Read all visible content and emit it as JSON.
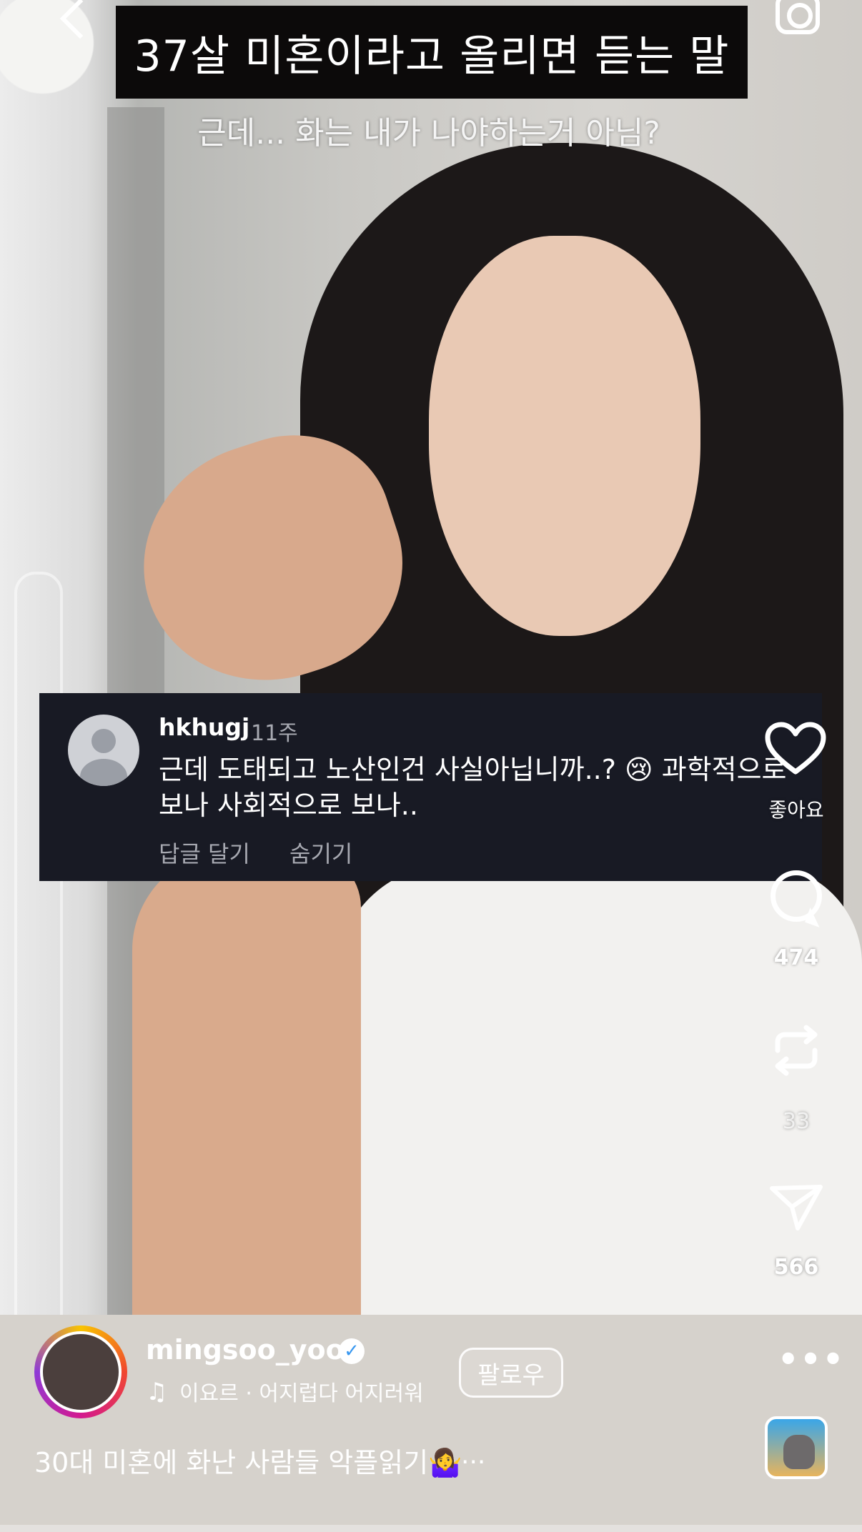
{
  "overlay": {
    "title": "37살 미혼이라고 올리면 듣는 말",
    "subtitle": "근데... 화는 내가 나야하는거 아님?"
  },
  "comment": {
    "username": "hkhugj",
    "time": "11주",
    "text": "근데 도태되고 노산인건 사실아닙니까..? 😢 과학적으로\n보나 사회적으로 보나..",
    "reply_label": "답글 달기",
    "hide_label": "숨기기"
  },
  "actions": {
    "like_label": "좋아요",
    "comments_count": "474",
    "reposts_count": "33",
    "shares_count": "566",
    "more_label": "•••"
  },
  "author": {
    "username": "mingsoo_yoo",
    "verified": true,
    "follow_label": "팔로우",
    "music": "이요르 · 어지럽다 어지러워",
    "caption": "30대 미혼에 화난 사람들 악플읽기🤷‍♀️",
    "caption_more": "..."
  },
  "icons": [
    "back-arrow-icon",
    "camera-icon",
    "heart-icon",
    "comment-icon",
    "repost-icon",
    "send-icon",
    "more-icon",
    "music-note-icon",
    "verified-badge-icon"
  ],
  "colors": {
    "comment_bg": "#181a24",
    "title_bg": "#0c0a0a",
    "verified": "#3897f0"
  }
}
